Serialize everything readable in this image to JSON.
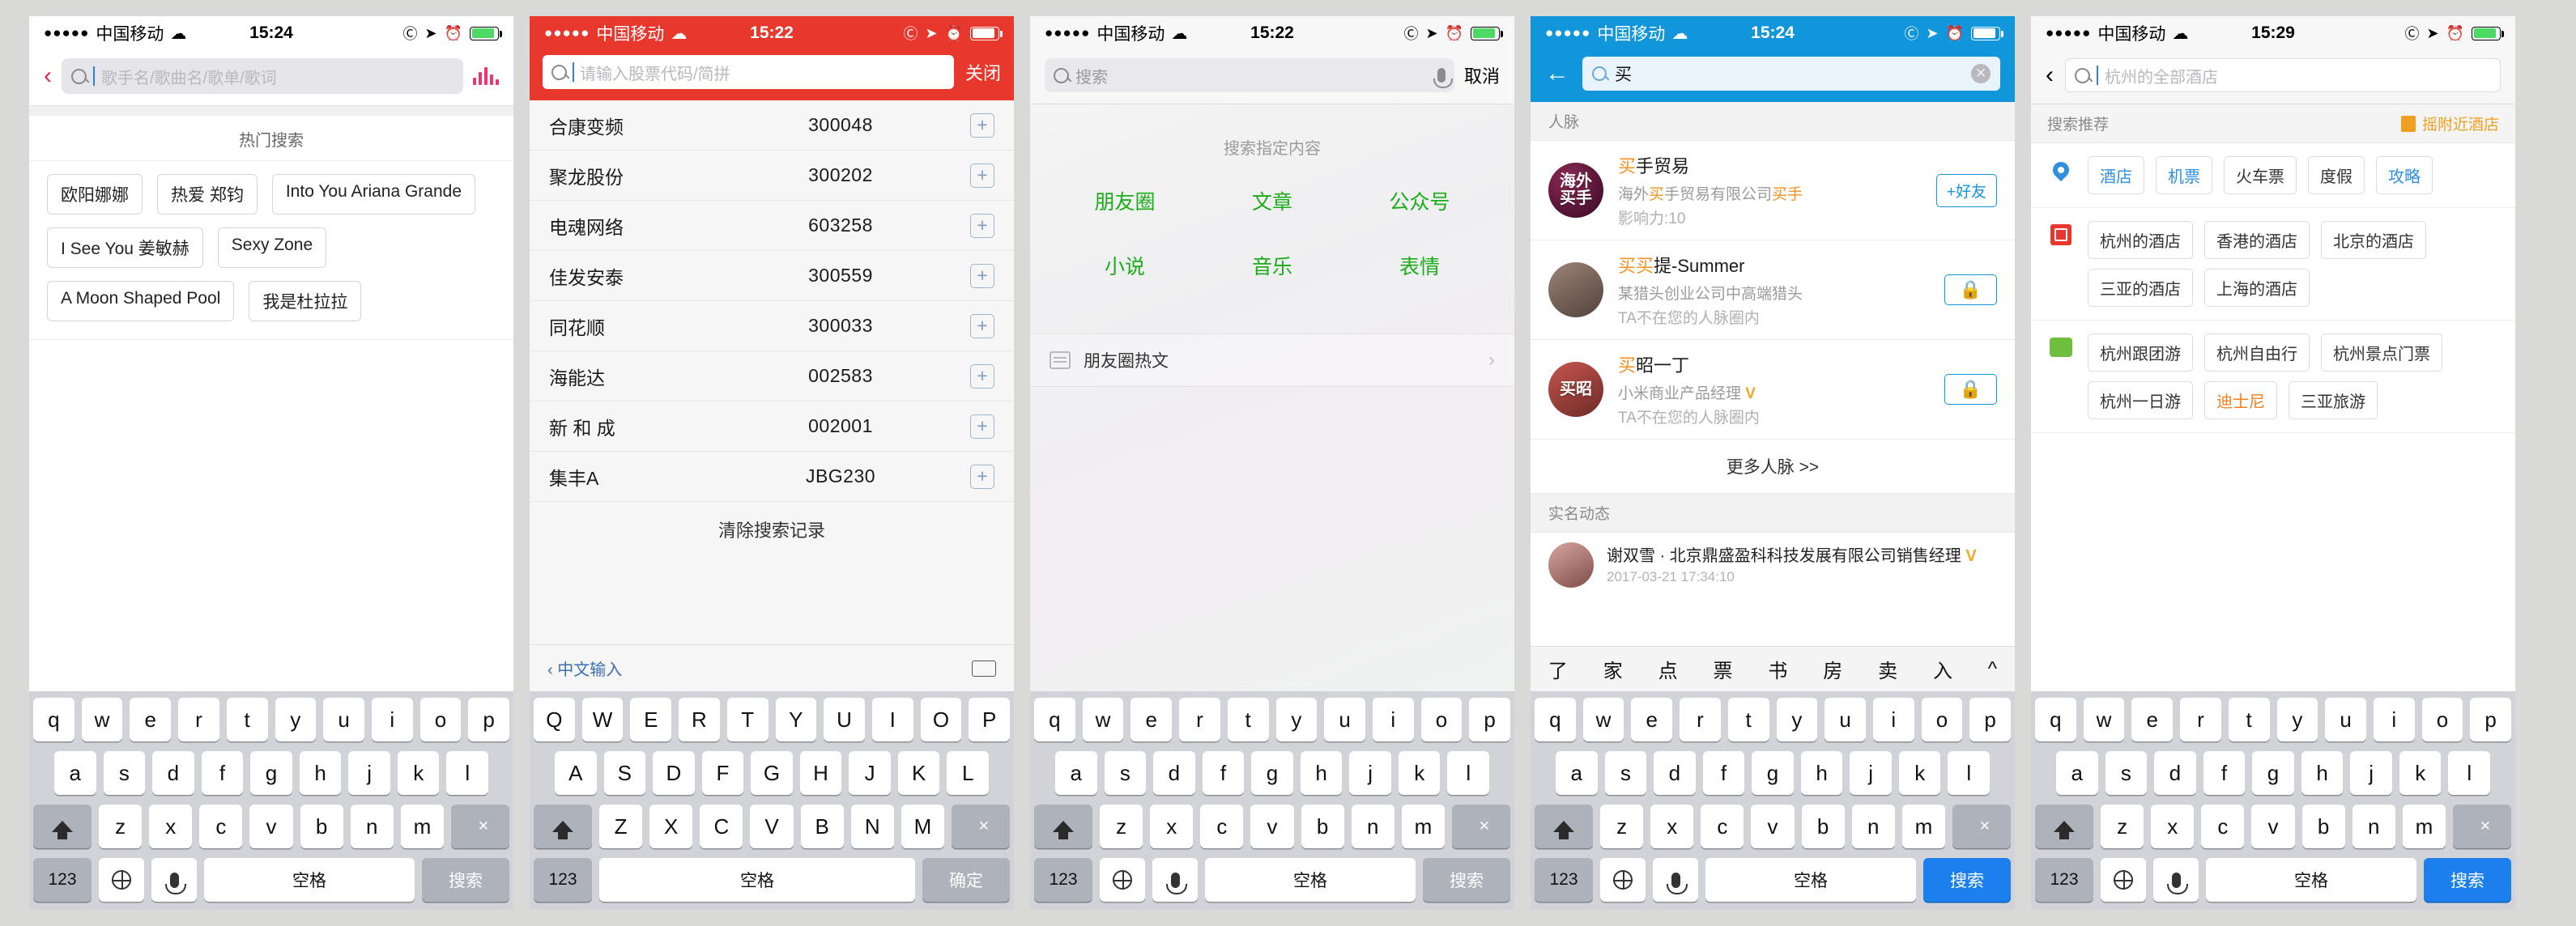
{
  "phones": [
    {
      "id": "music-search",
      "status": {
        "dots": "●●●●●",
        "carrier": "中国移动",
        "wifi": "wifi-icon",
        "time": "15:24",
        "icons": [
          "lock-rotation-icon",
          "location-icon",
          "alarm-icon",
          "battery-icon"
        ]
      },
      "nav": {
        "back": "‹",
        "placeholder": "歌手名/歌曲名/歌单/歌词",
        "eq": "equalizer-icon"
      },
      "hot_title": "热门搜索",
      "tags": [
        "欧阳娜娜",
        "热爱 郑钧",
        "Into You Ariana Grande",
        "I See You 姜敏赫",
        "Sexy Zone",
        "A Moon Shaped Pool",
        "我是杜拉拉"
      ],
      "keyboard": {
        "row1": [
          "q",
          "w",
          "e",
          "r",
          "t",
          "y",
          "u",
          "i",
          "o",
          "p"
        ],
        "row2": [
          "a",
          "s",
          "d",
          "f",
          "g",
          "h",
          "j",
          "k",
          "l"
        ],
        "row3": [
          "z",
          "x",
          "c",
          "v",
          "b",
          "n",
          "m"
        ],
        "num": "123",
        "space": "空格",
        "action": "搜索",
        "shift": "shift-icon",
        "delete": "delete-icon",
        "globe": "globe-icon",
        "mic": "mic-icon"
      }
    },
    {
      "id": "stock-search",
      "status": {
        "dots": "●●●●●",
        "carrier": "中国移动",
        "wifi": "wifi-icon",
        "time": "15:22",
        "icons": [
          "lock-rotation-icon",
          "location-icon",
          "alarm-icon",
          "battery-icon"
        ]
      },
      "nav": {
        "placeholder": "请输入股票代码/简拼",
        "close": "关闭"
      },
      "stocks": [
        {
          "name": "合康变频",
          "code": "300048"
        },
        {
          "name": "聚龙股份",
          "code": "300202"
        },
        {
          "name": "电魂网络",
          "code": "603258"
        },
        {
          "name": "佳发安泰",
          "code": "300559"
        },
        {
          "name": "同花顺",
          "code": "300033"
        },
        {
          "name": "海能达",
          "code": "002583"
        },
        {
          "name": "新 和 成",
          "code": "002001"
        },
        {
          "name": "集丰A",
          "code": "JBG230"
        }
      ],
      "clear": "清除搜索记录",
      "bottom": {
        "ime": "‹ 中文输入",
        "kb": "keyboard-icon"
      },
      "keyboard": {
        "row1": [
          "Q",
          "W",
          "E",
          "R",
          "T",
          "Y",
          "U",
          "I",
          "O",
          "P"
        ],
        "row2": [
          "A",
          "S",
          "D",
          "F",
          "G",
          "H",
          "J",
          "K",
          "L"
        ],
        "row3": [
          "Z",
          "X",
          "C",
          "V",
          "B",
          "N",
          "M"
        ],
        "num": "123",
        "space": "空格",
        "action": "确定",
        "shift": "shift-icon",
        "delete": "delete-icon"
      }
    },
    {
      "id": "wechat-search",
      "status": {
        "dots": "●●●●●",
        "carrier": "中国移动",
        "wifi": "wifi-icon",
        "time": "15:22",
        "icons": [
          "lock-rotation-icon",
          "location-icon",
          "alarm-icon",
          "battery-icon"
        ]
      },
      "nav": {
        "placeholder": "搜索",
        "mic": "mic-icon",
        "cancel": "取消"
      },
      "hint": "搜索指定内容",
      "categories": [
        "朋友圈",
        "文章",
        "公众号",
        "小说",
        "音乐",
        "表情"
      ],
      "hot_row": {
        "icon": "article-icon",
        "label": "朋友圈热文",
        "chevron": "›"
      },
      "keyboard": {
        "row1": [
          "q",
          "w",
          "e",
          "r",
          "t",
          "y",
          "u",
          "i",
          "o",
          "p"
        ],
        "row2": [
          "a",
          "s",
          "d",
          "f",
          "g",
          "h",
          "j",
          "k",
          "l"
        ],
        "row3": [
          "z",
          "x",
          "c",
          "v",
          "b",
          "n",
          "m"
        ],
        "num": "123",
        "space": "空格",
        "action": "搜索",
        "shift": "shift-icon",
        "delete": "delete-icon",
        "globe": "globe-icon",
        "mic": "mic-icon"
      }
    },
    {
      "id": "maimai-search",
      "status": {
        "dots": "●●●●●",
        "carrier": "中国移动",
        "wifi": "wifi-icon",
        "time": "15:24",
        "icons": [
          "lock-rotation-icon",
          "location-icon",
          "alarm-icon",
          "battery-icon"
        ]
      },
      "nav": {
        "back": "←",
        "value": "买",
        "clear": "✕"
      },
      "section_contacts": "人脉",
      "contacts": [
        {
          "avatar": "海外\n买手",
          "name_pre": "",
          "name_hl": "买",
          "name_post": "手贸易",
          "sub_pre": "海外",
          "sub_hl": "买",
          "sub_post": "手贸易有限公司",
          "sub_hl2": "买手",
          "meta": "影响力:10",
          "action": "+好友",
          "action_type": "friend"
        },
        {
          "avatar": "",
          "name_pre": "",
          "name_hl": "买买",
          "name_post": "提-Summer",
          "sub_pre": "某猎头创业公司中高端猎头",
          "sub_hl": "",
          "sub_post": "",
          "meta": "TA不在您的人脉圈内",
          "action": "lock-icon",
          "action_type": "lock"
        },
        {
          "avatar": "买昭",
          "name_pre": "",
          "name_hl": "买",
          "name_post": "昭一丁",
          "sub_pre": "小米商业产品经理",
          "sub_hl": "",
          "sub_post": "",
          "verified": "V",
          "meta": "TA不在您的人脉圈内",
          "action": "lock-icon",
          "action_type": "lock"
        }
      ],
      "more": "更多人脉 >>",
      "section_feed": "实名动态",
      "feed": {
        "name": "谢双雪 · 北京鼎盛盈科科技发展有限公司销售经理",
        "verified": "V",
        "time": "2017-03-21 17:34:10"
      },
      "suggest_strip": [
        "了",
        "家",
        "点",
        "票",
        "书",
        "房",
        "卖",
        "入",
        "^"
      ],
      "keyboard": {
        "row1": [
          "q",
          "w",
          "e",
          "r",
          "t",
          "y",
          "u",
          "i",
          "o",
          "p"
        ],
        "row2": [
          "a",
          "s",
          "d",
          "f",
          "g",
          "h",
          "j",
          "k",
          "l"
        ],
        "row3": [
          "z",
          "x",
          "c",
          "v",
          "b",
          "n",
          "m"
        ],
        "num": "123",
        "space": "空格",
        "action": "搜索",
        "shift": "shift-icon",
        "delete": "delete-icon",
        "globe": "globe-icon",
        "mic": "mic-icon"
      }
    },
    {
      "id": "hotel-search",
      "status": {
        "dots": "●●●●●",
        "carrier": "中国移动",
        "wifi": "wifi-icon",
        "time": "15:29",
        "icons": [
          "lock-rotation-icon",
          "location-icon",
          "alarm-icon",
          "battery-icon"
        ]
      },
      "nav": {
        "back": "‹",
        "placeholder": "杭州的全部酒店"
      },
      "section": "搜索推荐",
      "near": {
        "icon": "near-icon",
        "label": "摇附近酒店"
      },
      "groups": [
        {
          "icon": "pin-icon",
          "rows": [
            [
              {
                "text": "酒店",
                "style": "blue"
              },
              {
                "text": "机票",
                "style": "blue"
              },
              {
                "text": "火车票",
                "style": "plain"
              },
              {
                "text": "度假",
                "style": "plain"
              },
              {
                "text": "攻略",
                "style": "blue"
              }
            ]
          ]
        },
        {
          "icon": "red-box-icon",
          "rows": [
            [
              {
                "text": "杭州的酒店",
                "style": "plain"
              },
              {
                "text": "香港的酒店",
                "style": "plain"
              },
              {
                "text": "北京的酒店",
                "style": "plain"
              }
            ],
            [
              {
                "text": "三亚的酒店",
                "style": "plain"
              },
              {
                "text": "上海的酒店",
                "style": "plain"
              }
            ]
          ]
        },
        {
          "icon": "green-icon",
          "rows": [
            [
              {
                "text": "杭州跟团游",
                "style": "plain"
              },
              {
                "text": "杭州自由行",
                "style": "plain"
              },
              {
                "text": "杭州景点门票",
                "style": "plain"
              }
            ],
            [
              {
                "text": "杭州一日游",
                "style": "plain"
              },
              {
                "text": "迪士尼",
                "style": "orange"
              },
              {
                "text": "三亚旅游",
                "style": "plain"
              }
            ]
          ]
        }
      ],
      "keyboard": {
        "row1": [
          "q",
          "w",
          "e",
          "r",
          "t",
          "y",
          "u",
          "i",
          "o",
          "p"
        ],
        "row2": [
          "a",
          "s",
          "d",
          "f",
          "g",
          "h",
          "j",
          "k",
          "l"
        ],
        "row3": [
          "z",
          "x",
          "c",
          "v",
          "b",
          "n",
          "m"
        ],
        "num": "123",
        "space": "空格",
        "action": "搜索",
        "shift": "shift-icon",
        "delete": "delete-icon",
        "globe": "globe-icon",
        "mic": "mic-icon"
      }
    }
  ],
  "colors": {
    "red": "#e8382e",
    "blue": "#1296db",
    "green": "#1aad19",
    "pink": "#e8224c",
    "orange": "#f6921e",
    "keyboard_blue": "#1b80ee"
  }
}
